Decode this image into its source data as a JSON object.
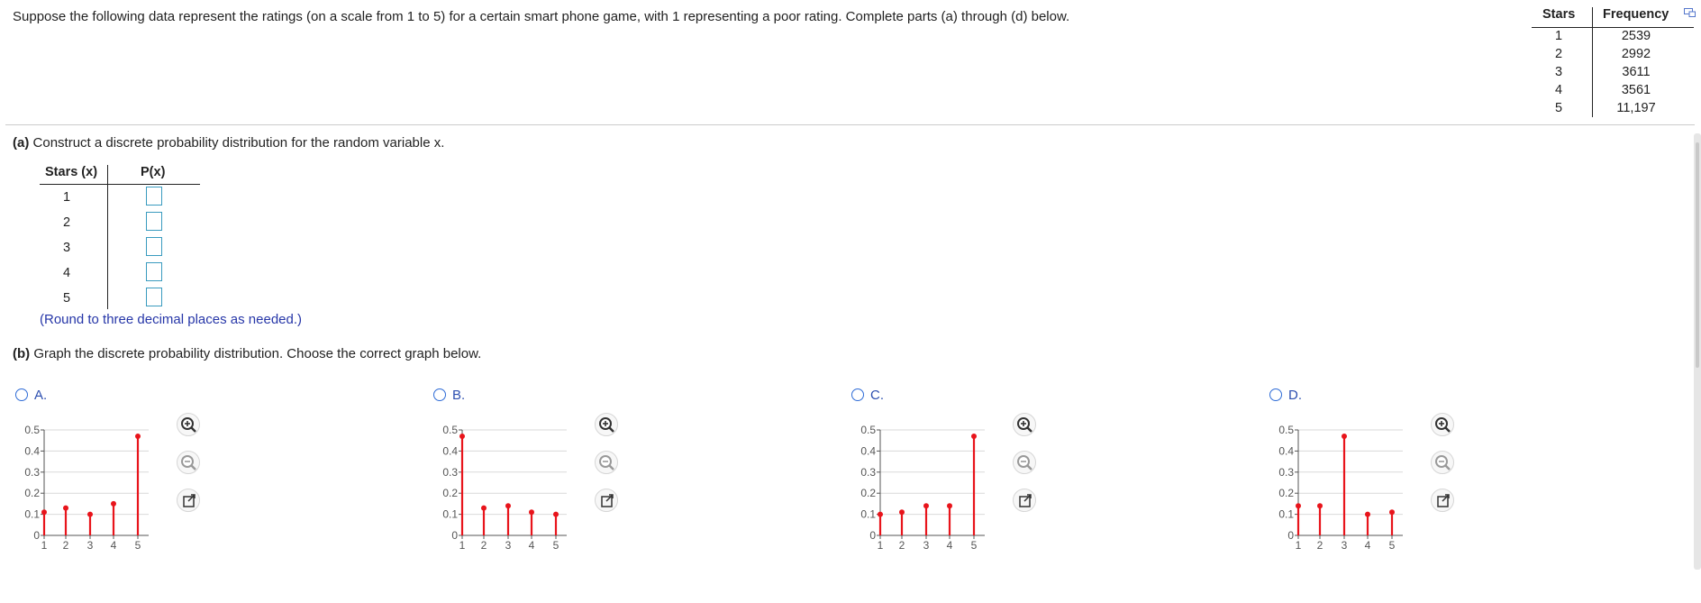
{
  "question": {
    "intro": "Suppose the following data represent the ratings (on a scale from 1 to 5) for a certain smart phone game, with 1 representing a poor rating. Complete parts (a) through (d) below."
  },
  "data_table": {
    "headers": [
      "Stars",
      "Frequency"
    ],
    "rows": [
      {
        "stars": "1",
        "frequency": "2539"
      },
      {
        "stars": "2",
        "frequency": "2992"
      },
      {
        "stars": "3",
        "frequency": "3611"
      },
      {
        "stars": "4",
        "frequency": "3561"
      },
      {
        "stars": "5",
        "frequency": "11,197"
      }
    ]
  },
  "part_a": {
    "label": "(a)",
    "text": "Construct a discrete probability distribution for the random variable x.",
    "headers": [
      "Stars (x)",
      "P(x)"
    ],
    "rows": [
      {
        "x": "1",
        "value": ""
      },
      {
        "x": "2",
        "value": ""
      },
      {
        "x": "3",
        "value": ""
      },
      {
        "x": "4",
        "value": ""
      },
      {
        "x": "5",
        "value": ""
      }
    ],
    "note": "(Round to three decimal places as needed.)"
  },
  "part_b": {
    "label": "(b)",
    "text": "Graph the discrete probability distribution. Choose the correct graph below."
  },
  "options": [
    {
      "letter": "A."
    },
    {
      "letter": "B."
    },
    {
      "letter": "C."
    },
    {
      "letter": "D."
    }
  ],
  "icons": {
    "zoom_in": "zoom-in-icon",
    "zoom_out": "zoom-out-icon",
    "popout": "popout-icon"
  },
  "colors": {
    "stem": "#e8141b",
    "accent": "#2d6bd6",
    "input_border": "#3a9bbf",
    "note": "#2636a8"
  },
  "chart_data": [
    {
      "type": "bar",
      "x": [
        1,
        2,
        3,
        4,
        5
      ],
      "values": [
        0.11,
        0.13,
        0.1,
        0.15,
        0.47
      ],
      "ylim": [
        0,
        0.5
      ],
      "yticks": [
        "0",
        "0.1",
        "0.2",
        "0.3",
        "0.4",
        "0.5"
      ],
      "xticks": [
        "1",
        "2",
        "3",
        "4",
        "5"
      ]
    },
    {
      "type": "bar",
      "x": [
        1,
        2,
        3,
        4,
        5
      ],
      "values": [
        0.47,
        0.13,
        0.14,
        0.11,
        0.1
      ],
      "ylim": [
        0,
        0.5
      ],
      "yticks": [
        "0",
        "0.1",
        "0.2",
        "0.3",
        "0.4",
        "0.5"
      ],
      "xticks": [
        "1",
        "2",
        "3",
        "4",
        "5"
      ]
    },
    {
      "type": "bar",
      "x": [
        1,
        2,
        3,
        4,
        5
      ],
      "values": [
        0.1,
        0.11,
        0.14,
        0.14,
        0.47
      ],
      "ylim": [
        0,
        0.5
      ],
      "yticks": [
        "0",
        "0.1",
        "0.2",
        "0.3",
        "0.4",
        "0.5"
      ],
      "xticks": [
        "1",
        "2",
        "3",
        "4",
        "5"
      ]
    },
    {
      "type": "bar",
      "x": [
        1,
        2,
        3,
        4,
        5
      ],
      "values": [
        0.14,
        0.14,
        0.47,
        0.1,
        0.11
      ],
      "ylim": [
        0,
        0.5
      ],
      "yticks": [
        "0",
        "0.1",
        "0.2",
        "0.3",
        "0.4",
        "0.5"
      ],
      "xticks": [
        "1",
        "2",
        "3",
        "4",
        "5"
      ]
    }
  ]
}
